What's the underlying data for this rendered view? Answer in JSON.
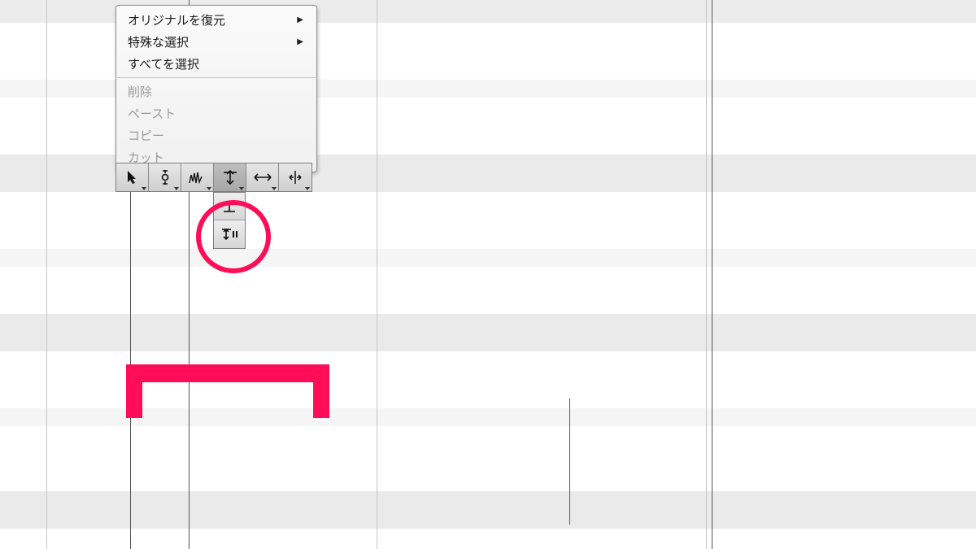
{
  "menu": {
    "restore_original": "オリジナルを復元",
    "special_select": "特殊な選択",
    "select_all": "すべてを選択",
    "delete": "削除",
    "paste": "ペースト",
    "copy": "コピー",
    "cut": "カット"
  },
  "toolbar": {
    "buttons": [
      {
        "name": "pointer",
        "has_dropdown": true,
        "selected": false
      },
      {
        "name": "pitch-tool",
        "has_dropdown": true,
        "selected": false
      },
      {
        "name": "vibrato-tool",
        "has_dropdown": true,
        "selected": false
      },
      {
        "name": "formant-tool",
        "has_dropdown": true,
        "selected": true
      },
      {
        "name": "time-tool",
        "has_dropdown": true,
        "selected": false
      },
      {
        "name": "split-tool",
        "has_dropdown": true,
        "selected": false
      }
    ]
  },
  "annotation": {
    "circle_color": "#ff0d58",
    "bracket_color": "#ff0d58"
  }
}
